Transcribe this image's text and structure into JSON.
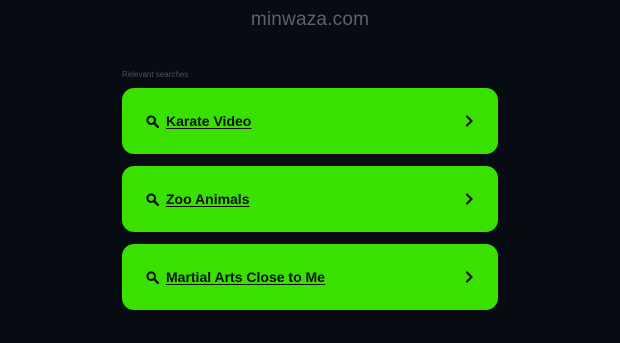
{
  "header": {
    "domain": "minwaza.com"
  },
  "related": {
    "label": "Relevant searches",
    "items": [
      {
        "label": "Karate Video",
        "icon": "search-icon",
        "arrow": "chevron-right-icon"
      },
      {
        "label": "Zoo Animals",
        "icon": "search-icon",
        "arrow": "chevron-right-icon"
      },
      {
        "label": "Martial Arts Close to Me",
        "icon": "search-icon",
        "arrow": "chevron-right-icon"
      }
    ]
  },
  "colors": {
    "background": "#070b12",
    "button": "#39e000",
    "button_text": "#0a0f0a",
    "domain_text": "#5f6166"
  }
}
